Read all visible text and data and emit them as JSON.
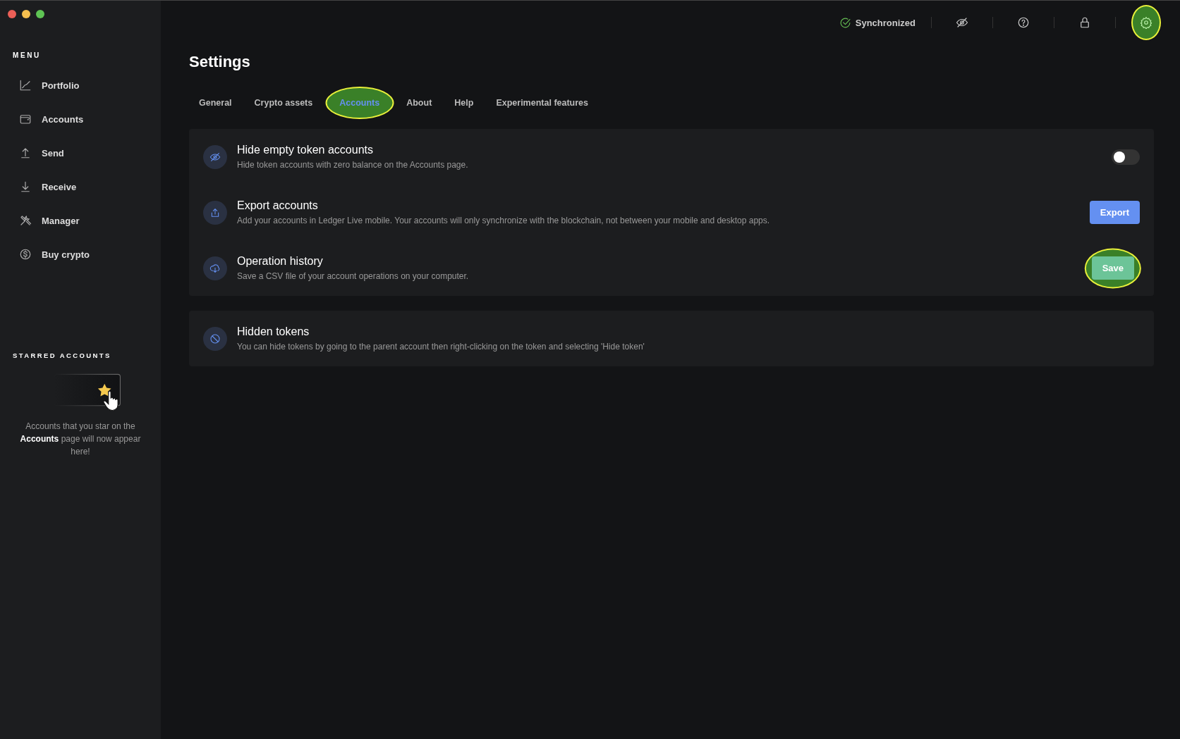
{
  "window": {
    "controls": [
      {
        "color": "#ec5f57"
      },
      {
        "color": "#f5bf4f"
      },
      {
        "color": "#5fc454"
      }
    ]
  },
  "sidebar": {
    "menu_label": "MENU",
    "items": [
      {
        "label": "Portfolio",
        "selected": false
      },
      {
        "label": "Accounts",
        "selected": false
      },
      {
        "label": "Send",
        "selected": false
      },
      {
        "label": "Receive",
        "selected": false
      },
      {
        "label": "Manager",
        "selected": false
      },
      {
        "label": "Buy crypto",
        "selected": false
      }
    ],
    "starred": {
      "label": "STARRED ACCOUNTS",
      "message": "Accounts that you star on the **Accounts** page will now appear here!"
    }
  },
  "topbar": {
    "sync_status": "Synchronized",
    "actions": [
      {
        "highlighted": false
      },
      {
        "highlighted": false
      },
      {
        "highlighted": false
      },
      {
        "highlighted": true
      }
    ]
  },
  "page": {
    "title": "Settings",
    "tabs": [
      {
        "label": "General",
        "selected": false,
        "highlighted": false
      },
      {
        "label": "Crypto assets",
        "selected": false,
        "highlighted": false
      },
      {
        "label": "Accounts",
        "selected": true,
        "highlighted": true
      },
      {
        "label": "About",
        "selected": false,
        "highlighted": false
      },
      {
        "label": "Help",
        "selected": false,
        "highlighted": false
      },
      {
        "label": "Experimental features",
        "selected": false,
        "highlighted": false
      }
    ],
    "sections": [
      {
        "rows": [
          {
            "title": "Hide empty token accounts",
            "description": "Hide token accounts with zero balance on the Accounts page.",
            "control": {
              "kind": "toggle",
              "on": false
            }
          },
          {
            "title": "Export accounts",
            "description": "Add your accounts in Ledger Live mobile. Your accounts will only synchronize with the blockchain, not between your mobile and desktop apps.",
            "control": {
              "kind": "button",
              "label": "Export",
              "highlighted": false
            }
          },
          {
            "title": "Operation history",
            "description": "Save a CSV file of your account operations on your computer.",
            "control": {
              "kind": "button",
              "label": "Save",
              "highlighted": true
            }
          }
        ]
      },
      {
        "rows": [
          {
            "title": "Hidden tokens",
            "description": "You can hide tokens by going to the parent account then right-clicking on the token and selecting 'Hide token'"
          }
        ]
      }
    ]
  }
}
